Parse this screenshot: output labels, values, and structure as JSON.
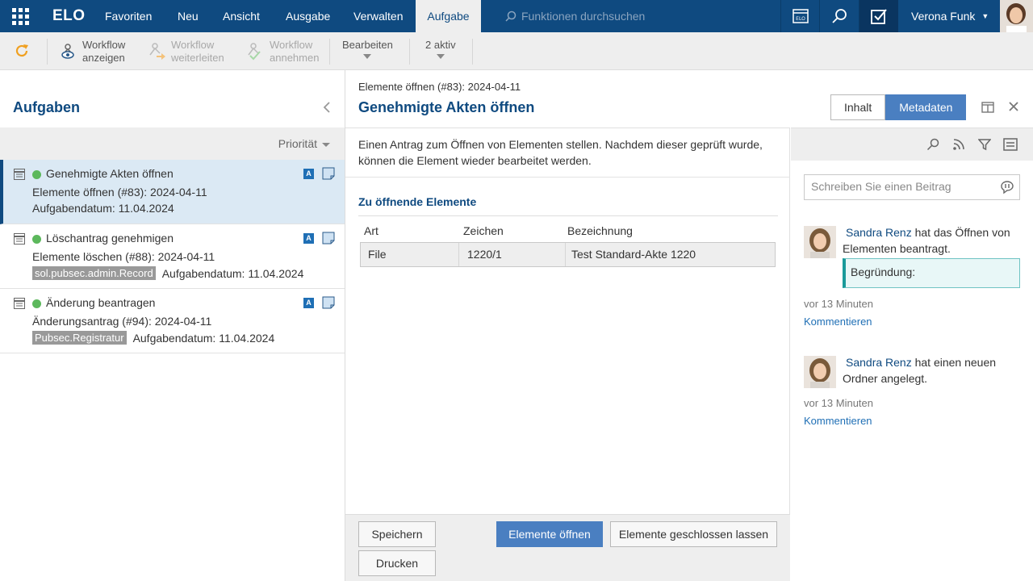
{
  "topbar": {
    "logo": "ELO",
    "nav": [
      "Favoriten",
      "Neu",
      "Ansicht",
      "Ausgabe",
      "Verwalten",
      "Aufgabe"
    ],
    "active_tab": "Aufgabe",
    "search_placeholder": "Funktionen durchsuchen",
    "user_name": "Verona Funk"
  },
  "ribbon": {
    "show_workflow": [
      "Workflow",
      "anzeigen"
    ],
    "forward_workflow": [
      "Workflow",
      "weiterleiten"
    ],
    "accept_workflow": [
      "Workflow",
      "annehmen"
    ],
    "edit": "Bearbeiten",
    "active_count": "2 aktiv"
  },
  "tasks_panel": {
    "title": "Aufgaben",
    "sort_label": "Priorität",
    "tasks": [
      {
        "title": "Genehmigte Akten öffnen",
        "subtitle": "Elemente öffnen (#83): 2024-04-11",
        "tag": "",
        "date": "Aufgabendatum: 11.04.2024",
        "badge": "A"
      },
      {
        "title": "Löschantrag genehmigen",
        "subtitle": "Elemente löschen (#88): 2024-04-11",
        "tag": "sol.pubsec.admin.Record",
        "date": "Aufgabendatum: 11.04.2024",
        "badge": "A"
      },
      {
        "title": "Änderung beantragen",
        "subtitle": "Änderungsantrag (#94): 2024-04-11",
        "tag": "Pubsec.Registratur",
        "date": "Aufgabendatum: 11.04.2024",
        "badge": "A"
      }
    ]
  },
  "main": {
    "breadcrumb": "Elemente öffnen (#83): 2024-04-11",
    "title": "Genehmigte Akten öffnen",
    "tabs": [
      "Inhalt",
      "Metadaten"
    ],
    "active_tab": "Metadaten",
    "description": "Einen Antrag zum Öffnen von Elementen stellen. Nachdem dieser geprüft wurde, können die Element wieder bearbeitet werden.",
    "section_title": "Zu öffnende Elemente",
    "table": {
      "headers": [
        "Art",
        "Zeichen",
        "Bezeichnung"
      ],
      "rows": [
        [
          "File",
          "1220/1",
          "Test Standard-Akte 1220"
        ]
      ]
    },
    "buttons": {
      "save": "Speichern",
      "print": "Drucken",
      "open_elements": "Elemente öffnen",
      "keep_closed": "Elemente geschlossen lassen"
    }
  },
  "feed": {
    "input_placeholder": "Schreiben Sie einen Beitrag",
    "items": [
      {
        "author": "Sandra Renz",
        "text": "hat das Öffnen von Elementen beantragt.",
        "reason": "Begründung:",
        "time": "vor 13 Minuten",
        "action": "Kommentieren"
      },
      {
        "author": "Sandra Renz",
        "text": "hat einen neuen Ordner angelegt.",
        "reason": "",
        "time": "vor 13 Minuten",
        "action": "Kommentieren"
      }
    ]
  },
  "colors": {
    "brand": "#0f4a80",
    "primary_button": "#4a7fc1",
    "status_green": "#5cb85c",
    "reason_accent": "#1a9a9a"
  }
}
